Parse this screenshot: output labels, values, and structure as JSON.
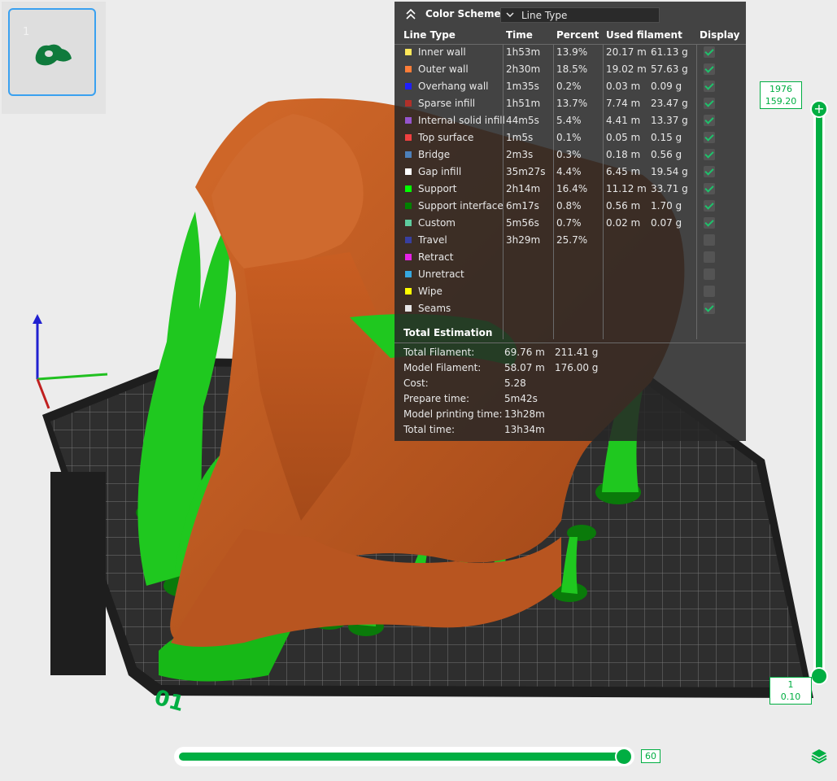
{
  "plate_thumbnail": {
    "number": "1"
  },
  "legend": {
    "color_scheme_label": "Color Scheme",
    "selected_scheme": "Line Type",
    "headers": {
      "line_type": "Line Type",
      "time": "Time",
      "percent": "Percent",
      "used_filament": "Used filament",
      "display": "Display"
    },
    "rows": [
      {
        "name": "Inner wall",
        "color": "#ffe75a",
        "time": "1h53m",
        "percent": "13.9%",
        "length": "20.17 m",
        "weight": "61.13 g",
        "display": true
      },
      {
        "name": "Outer wall",
        "color": "#ff7d38",
        "time": "2h30m",
        "percent": "18.5%",
        "length": "19.02 m",
        "weight": "57.63 g",
        "display": true
      },
      {
        "name": "Overhang wall",
        "color": "#1f1fff",
        "time": "1m35s",
        "percent": "0.2%",
        "length": "0.03 m",
        "weight": "0.09 g",
        "display": true
      },
      {
        "name": "Sparse infill",
        "color": "#b03029",
        "time": "1h51m",
        "percent": "13.7%",
        "length": "7.74 m",
        "weight": "23.47 g",
        "display": true
      },
      {
        "name": "Internal solid infill",
        "color": "#9654cc",
        "time": "44m5s",
        "percent": "5.4%",
        "length": "4.41 m",
        "weight": "13.37 g",
        "display": true
      },
      {
        "name": "Top surface",
        "color": "#f04040",
        "time": "1m5s",
        "percent": "0.1%",
        "length": "0.05 m",
        "weight": "0.15 g",
        "display": true
      },
      {
        "name": "Bridge",
        "color": "#4d80ba",
        "time": "2m3s",
        "percent": "0.3%",
        "length": "0.18 m",
        "weight": "0.56 g",
        "display": true
      },
      {
        "name": "Gap infill",
        "color": "#ffffff",
        "time": "35m27s",
        "percent": "4.4%",
        "length": "6.45 m",
        "weight": "19.54 g",
        "display": true
      },
      {
        "name": "Support",
        "color": "#00ff00",
        "time": "2h14m",
        "percent": "16.4%",
        "length": "11.12 m",
        "weight": "33.71 g",
        "display": true
      },
      {
        "name": "Support interface",
        "color": "#008000",
        "time": "6m17s",
        "percent": "0.8%",
        "length": "0.56 m",
        "weight": "1.70 g",
        "display": true
      },
      {
        "name": "Custom",
        "color": "#5ecc9e",
        "time": "5m56s",
        "percent": "0.7%",
        "length": "0.02 m",
        "weight": "0.07 g",
        "display": true
      },
      {
        "name": "Travel",
        "color": "#383fa0",
        "time": "3h29m",
        "percent": "25.7%",
        "length": "",
        "weight": "",
        "display": false
      },
      {
        "name": "Retract",
        "color": "#e622e6",
        "time": "",
        "percent": "",
        "length": "",
        "weight": "",
        "display": false
      },
      {
        "name": "Unretract",
        "color": "#36a8e0",
        "time": "",
        "percent": "",
        "length": "",
        "weight": "",
        "display": false
      },
      {
        "name": "Wipe",
        "color": "#ffff00",
        "time": "",
        "percent": "",
        "length": "",
        "weight": "",
        "display": false
      },
      {
        "name": "Seams",
        "color": "#e6e6e6",
        "time": "",
        "percent": "",
        "length": "",
        "weight": "",
        "display": true
      }
    ],
    "total_estimation": {
      "title": "Total Estimation",
      "items": [
        {
          "label": "Total Filament:",
          "value": "69.76 m",
          "value2": "211.41 g"
        },
        {
          "label": "Model Filament:",
          "value": "58.07 m",
          "value2": "176.00 g"
        },
        {
          "label": "Cost:",
          "value": "5.28",
          "value2": ""
        },
        {
          "label": "Prepare time:",
          "value": "5m42s",
          "value2": ""
        },
        {
          "label": "Model printing time:",
          "value": "13h28m",
          "value2": ""
        },
        {
          "label": "Total time:",
          "value": "13h34m",
          "value2": ""
        }
      ]
    }
  },
  "layer_slider": {
    "top_layer": "1976",
    "top_height": "159.20",
    "bottom_layer": "1",
    "bottom_height": "0.10"
  },
  "move_slider": {
    "value": "60",
    "fraction": 1.0
  },
  "bed_label": "01",
  "colors": {
    "accent": "#00ae42",
    "model": "#c0561f",
    "support": "#19c019",
    "bed": "#2c2c2c"
  }
}
